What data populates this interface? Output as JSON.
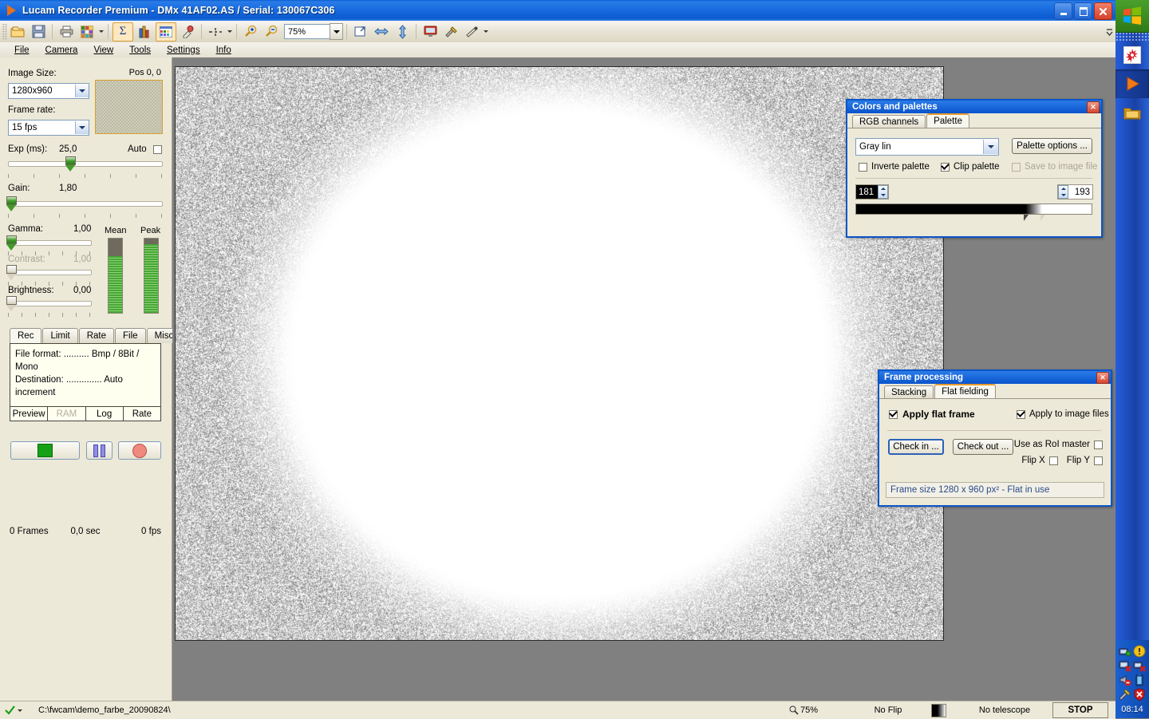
{
  "window": {
    "title": "Lucam Recorder Premium - DMx 41AF02.AS / Serial: 130067C306",
    "icon": "play-triangle-icon",
    "minimize_label": "_",
    "maximize_label": "❐",
    "close_label": "✕"
  },
  "toolbar": {
    "zoom_value": "75%",
    "buttons": [
      {
        "name": "open-folder-icon",
        "label": ""
      },
      {
        "name": "save-icon",
        "label": ""
      },
      {
        "name": "print-icon",
        "label": ""
      },
      {
        "name": "color-grid-icon",
        "label": ""
      },
      {
        "name": "sigma-sum-icon",
        "label": "Σ"
      },
      {
        "name": "histogram-icon",
        "label": ""
      },
      {
        "name": "palette-table-icon",
        "label": ""
      },
      {
        "name": "eyedropper-icon",
        "label": ""
      },
      {
        "name": "crosshair-icon",
        "label": ""
      },
      {
        "name": "zoom-in-icon",
        "label": ""
      },
      {
        "name": "zoom-out-icon",
        "label": ""
      },
      {
        "name": "fit-window-icon",
        "label": ""
      },
      {
        "name": "flip-horizontal-icon",
        "label": ""
      },
      {
        "name": "flip-vertical-icon",
        "label": ""
      },
      {
        "name": "monitor-icon",
        "label": ""
      },
      {
        "name": "tools-icon",
        "label": ""
      },
      {
        "name": "wand-icon",
        "label": ""
      }
    ]
  },
  "menubar": {
    "items": [
      "File",
      "Camera",
      "View",
      "Tools",
      "Settings",
      "Info"
    ]
  },
  "left_panel": {
    "image_size_label": "Image Size:",
    "image_size_value": "1280x960",
    "pos_label": "Pos 0, 0",
    "frame_rate_label": "Frame rate:",
    "frame_rate_value": "15 fps",
    "exposure_label": "Exp (ms):",
    "exposure_value": "25,0",
    "auto_label": "Auto",
    "auto_checked": false,
    "gain_label": "Gain:",
    "gain_value": "1,80",
    "gamma_label": "Gamma:",
    "gamma_value": "1,00",
    "contrast_label": "Contrast:",
    "contrast_value": "1,00",
    "contrast_disabled": true,
    "brightness_label": "Brightness:",
    "brightness_value": "0,00",
    "mean_label": "Mean",
    "peak_label": "Peak",
    "mean_percent": 76,
    "peak_percent": 93,
    "tabs": [
      {
        "label": "Rec",
        "selected": true
      },
      {
        "label": "Limit",
        "selected": false
      },
      {
        "label": "Rate",
        "selected": false
      },
      {
        "label": "File",
        "selected": false
      },
      {
        "label": "Misc",
        "selected": false
      }
    ],
    "info_lines": [
      "File format: .......... Bmp / 8Bit / Mono",
      "Destination: .............. Auto increment"
    ],
    "info_footer": [
      {
        "label": "Preview",
        "disabled": false
      },
      {
        "label": "RAM",
        "disabled": true
      },
      {
        "label": "Log",
        "disabled": false
      },
      {
        "label": "Rate",
        "disabled": false
      }
    ],
    "transport": [
      {
        "name": "start-button",
        "icon": "green-square-icon"
      },
      {
        "name": "pause-button",
        "icon": "pause-bars-icon"
      },
      {
        "name": "record-button",
        "icon": "red-circle-icon"
      }
    ],
    "counters": {
      "frames": "0 Frames",
      "seconds": "0,0 sec",
      "fps": "0 fps"
    }
  },
  "colors_dialog": {
    "title": "Colors and palettes",
    "tabs": [
      {
        "label": "RGB channels",
        "selected": false
      },
      {
        "label": "Palette",
        "selected": true
      }
    ],
    "palette_value": "Gray lin",
    "palette_options_label": "Palette options ...",
    "checkboxes": [
      {
        "label": "Inverte palette",
        "checked": false,
        "disabled": false
      },
      {
        "label": "Clip palette",
        "checked": true,
        "disabled": false
      },
      {
        "label": "Save to image file",
        "checked": false,
        "disabled": true
      }
    ],
    "low_value": "181",
    "high_value": "193",
    "gradient_start_pct": 72,
    "gradient_end_pct": 79
  },
  "frame_dialog": {
    "title": "Frame processing",
    "tabs": [
      {
        "label": "Stacking",
        "selected": false
      },
      {
        "label": "Flat fielding",
        "selected": true
      }
    ],
    "apply_flat_frame_label": "Apply flat frame",
    "apply_flat_frame_checked": true,
    "apply_to_image_files_label": "Apply to image files",
    "apply_to_image_files_checked": true,
    "check_in_label": "Check in ...",
    "check_out_label": "Check out ...",
    "use_as_roi_master_label": "Use as RoI master",
    "use_as_roi_master_checked": false,
    "flip_x_label": "Flip X",
    "flip_x_checked": false,
    "flip_y_label": "Flip Y",
    "flip_y_checked": false,
    "status": "Frame size 1280 x 960 px² - Flat in use"
  },
  "status_bar": {
    "path": "C:\\fwcam\\demo_farbe_20090824\\",
    "zoom": "75%",
    "flip": "No Flip",
    "telescope": "No telescope",
    "stop_label": "STOP"
  },
  "taskbar": {
    "start_label": "start",
    "quick_launch": [
      {
        "name": "taskbar-app-icon-firework"
      },
      {
        "name": "taskbar-app-icon-lucam",
        "active": true
      },
      {
        "name": "taskbar-app-icon-folder"
      }
    ],
    "tray_icons": [
      "tray-network-icon",
      "tray-warning-icon",
      "tray-display-error-icon",
      "tray-network-error-icon",
      "tray-volume-mute-icon",
      "tray-battery-icon",
      "tray-tools-icon",
      "tray-security-alert-icon"
    ],
    "clock": "08:14"
  },
  "colors": {
    "accent_blue": "#0a55c8",
    "title_blue": "#1b6ee0",
    "panel": "#ece9d8",
    "tab_highlight": "#e79b2d",
    "meter_green": "#46a832",
    "canvas_gray": "#808080"
  }
}
